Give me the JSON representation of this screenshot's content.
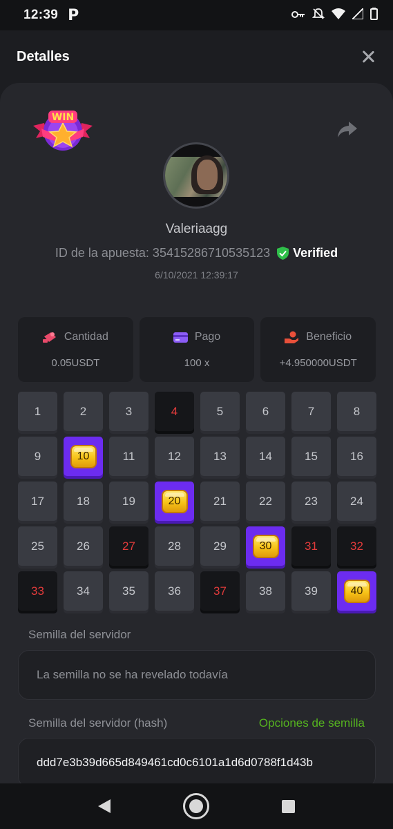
{
  "status_bar": {
    "time": "12:39",
    "app_glyph": "P",
    "icons": [
      "key-icon",
      "bell-off-icon",
      "wifi-icon",
      "signal-icon",
      "battery-icon"
    ]
  },
  "header": {
    "title": "Detalles"
  },
  "card": {
    "badge_text": "WIN",
    "username": "Valeriaagg",
    "bet_id": "ID de la apuesta: 3541528671053512",
    "bet_id_cut": "3",
    "verified_label": "Verified",
    "timestamp": "6/10/2021 12:39:17"
  },
  "stats": [
    {
      "icon": "coins-icon",
      "label": "Cantidad",
      "value": "0.05USDT",
      "color": "#e84a6a"
    },
    {
      "icon": "card-icon",
      "label": "Pago",
      "value": "100 x",
      "color": "#8b5cf6"
    },
    {
      "icon": "profit-hand-icon",
      "label": "Beneficio",
      "value": "+4.950000USDT",
      "color": "#e8503a"
    }
  ],
  "grid": {
    "numbers": [
      "1",
      "2",
      "3",
      "4",
      "5",
      "6",
      "7",
      "8",
      "9",
      "10",
      "11",
      "12",
      "13",
      "14",
      "15",
      "16",
      "17",
      "18",
      "19",
      "20",
      "21",
      "22",
      "23",
      "24",
      "25",
      "26",
      "27",
      "28",
      "29",
      "30",
      "31",
      "32",
      "33",
      "34",
      "35",
      "36",
      "37",
      "38",
      "39",
      "40"
    ],
    "states": [
      "n",
      "n",
      "n",
      "miss",
      "n",
      "n",
      "n",
      "n",
      "n",
      "hit",
      "n",
      "n",
      "n",
      "n",
      "n",
      "n",
      "n",
      "n",
      "n",
      "hit",
      "n",
      "n",
      "n",
      "n",
      "n",
      "n",
      "miss",
      "n",
      "n",
      "hit",
      "miss",
      "miss",
      "miss",
      "n",
      "n",
      "n",
      "miss",
      "n",
      "n",
      "hit"
    ]
  },
  "seeds": {
    "server_seed_label": "Semilla del servidor",
    "server_seed_placeholder": "La semilla no se ha revelado todavía",
    "server_hash_label": "Semilla del servidor (hash)",
    "seed_options_link": "Opciones de semilla",
    "server_hash_value": "ddd7e3b39d665d849461cd0c6101a1d6d0788f1d43b"
  },
  "colors": {
    "accent_green": "#55b31f",
    "hit_purple": "#6c2cf0",
    "miss_red": "#e23b3b"
  }
}
